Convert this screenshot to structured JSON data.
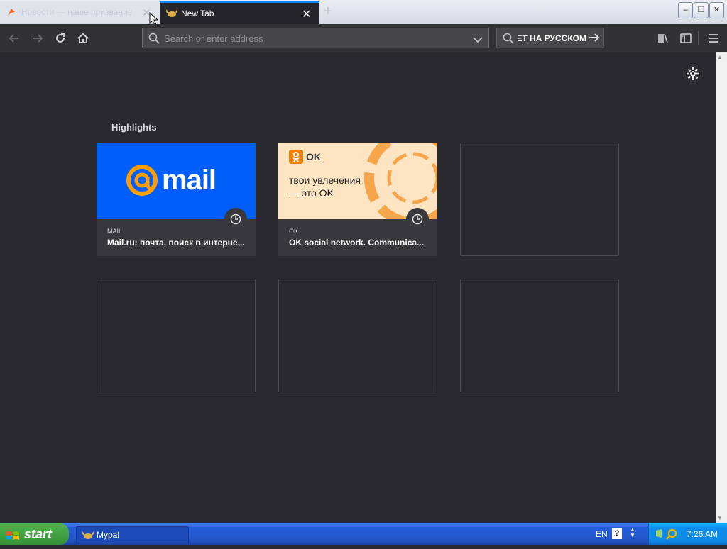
{
  "tabs": [
    {
      "title": "Новости — наше призвание на",
      "active": false
    },
    {
      "title": "New Tab",
      "active": true
    }
  ],
  "toolbar": {
    "url_placeholder": "Search or enter address",
    "search_text": "ЕТ НА РУССКОМ"
  },
  "page": {
    "highlights_title": "Highlights",
    "cards": [
      {
        "host": "MAIL",
        "title": "Mail.ru: почта, поиск в интерне...",
        "logo": "mail"
      },
      {
        "host": "OK",
        "title": "OK social network. Communica...",
        "brand": "OK",
        "slogan": "твои увлечения — это OK"
      }
    ]
  },
  "taskbar": {
    "start_label": "start",
    "window_button": "Mypal",
    "language": "EN",
    "clock": "7:26 AM"
  },
  "colors": {
    "accent": "#0a84ff",
    "mail_blue": "#005ff9",
    "mail_orange": "#ff9e00",
    "ok_orange": "#ee8208",
    "ok_bg": "#fde5c4"
  }
}
